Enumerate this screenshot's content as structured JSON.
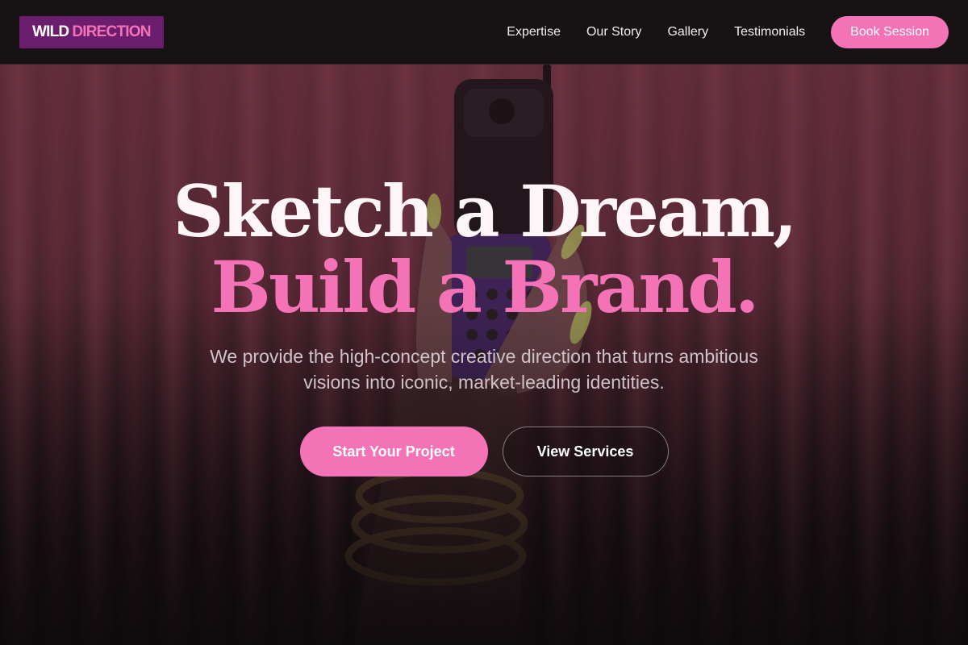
{
  "header": {
    "logo_part1": "WILD",
    "logo_part2": "DIRECTION",
    "nav": [
      "Expertise",
      "Our Story",
      "Gallery",
      "Testimonials"
    ],
    "cta_label": "Book Session"
  },
  "hero": {
    "headline_line1": "Sketch a Dream,",
    "headline_line2": "Build a Brand.",
    "subtitle": "We provide the high-concept creative direction that turns ambitious visions into iconic, market-leading identities.",
    "primary_cta": "Start Your Project",
    "secondary_cta": "View Services"
  },
  "colors": {
    "accent_pink": "#f472b6",
    "logo_bg": "#6b1d6e",
    "header_bg": "#171214"
  }
}
